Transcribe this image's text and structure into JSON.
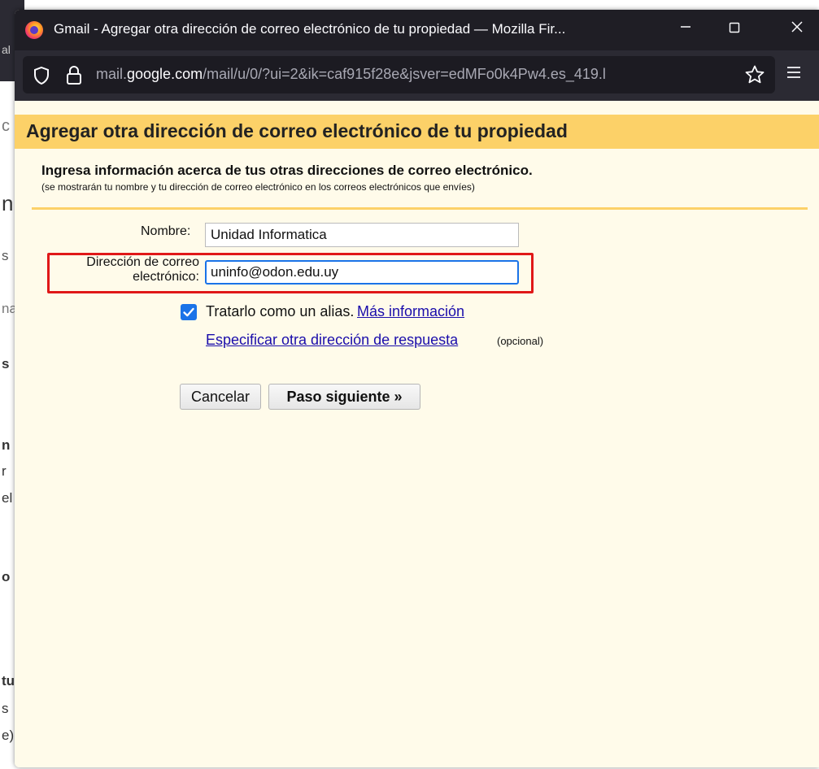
{
  "background_page": {
    "fragments": [
      "al",
      "c",
      "n",
      "s",
      "na",
      "s",
      "n",
      "r",
      "el",
      "o",
      "tu",
      "s",
      "e)"
    ]
  },
  "window": {
    "title": "Gmail - Agregar otra dirección de correo electrónico de tu propiedad — Mozilla Fir...",
    "minimize_icon": "minimize-icon",
    "maximize_icon": "maximize-icon",
    "close_icon": "close-icon"
  },
  "urlbar": {
    "url_prefix": "mail.",
    "url_host": "google.com",
    "url_path": "/mail/u/0/?ui=2&ik=caf915f28e&jsver=edMFo0k4Pw4.es_419.l"
  },
  "page": {
    "title": "Agregar otra dirección de correo electrónico de tu propiedad",
    "intro": "Ingresa información acerca de tus otras direcciones de correo electrónico.",
    "intro_sub": "(se mostrarán tu nombre y tu dirección de correo electrónico en los correos electrónicos que envíes)"
  },
  "form": {
    "name_label": "Nombre:",
    "name_value": "Unidad Informatica",
    "email_label_line1": "Dirección de correo",
    "email_label_line2": "electrónico:",
    "email_value": "uninfo@odon.edu.uy",
    "alias_checked": true,
    "alias_label": "Tratarlo como un alias.",
    "more_info_link": "Más información",
    "reply_link": "Especificar otra dirección de respuesta",
    "optional": "(opcional)",
    "cancel_label": "Cancelar",
    "next_label": "Paso siguiente »"
  },
  "colors": {
    "header_bar": "#fcd168",
    "content_bg": "#fffbea",
    "highlight_border": "#e01818",
    "checkbox": "#1a73e8"
  }
}
